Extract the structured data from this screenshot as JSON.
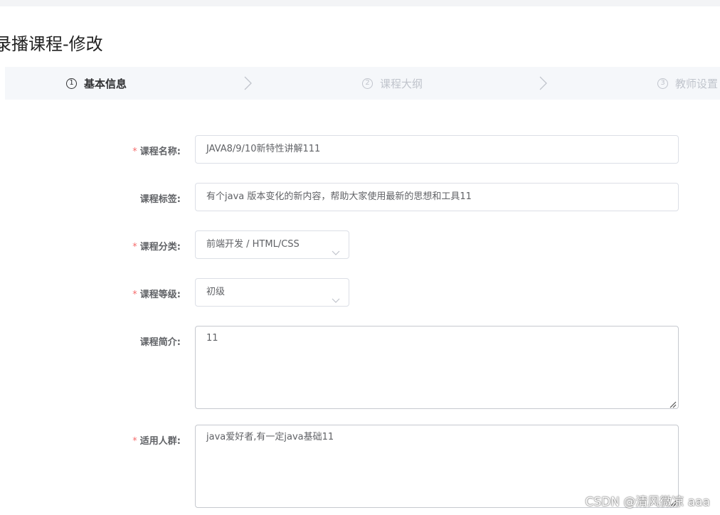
{
  "page": {
    "title": "录播课程-修改"
  },
  "steps": [
    {
      "number": "1",
      "label": "基本信息",
      "state": "active"
    },
    {
      "number": "2",
      "label": "课程大纲",
      "state": "inactive"
    },
    {
      "number": "3",
      "label": "教师设置",
      "state": "inactive"
    }
  ],
  "form": {
    "course_name": {
      "label": "课程名称:",
      "required": true,
      "value": "JAVA8/9/10新特性讲解111"
    },
    "course_tags": {
      "label": "课程标签:",
      "required": false,
      "value": "有个java 版本变化的新内容，帮助大家使用最新的思想和工具11"
    },
    "course_category": {
      "label": "课程分类:",
      "required": true,
      "value": "前端开发 / HTML/CSS"
    },
    "course_level": {
      "label": "课程等级:",
      "required": true,
      "value": "初级"
    },
    "course_intro": {
      "label": "课程简介:",
      "required": false,
      "value": "11"
    },
    "target_audience": {
      "label": "适用人群:",
      "required": true,
      "value": "java爱好者,有一定java基础11"
    }
  },
  "required_mark": "*",
  "watermark": "CSDN @清风微凉 aaa",
  "colors": {
    "required": "#f56c6c",
    "step_active": "#303133",
    "step_inactive": "#c0c4cc",
    "border": "#dcdfe6"
  },
  "icons": {
    "step_separator": "chevron-right-icon",
    "select_arrow": "chevron-down-icon",
    "textarea_resize": "resize-handle-icon"
  }
}
